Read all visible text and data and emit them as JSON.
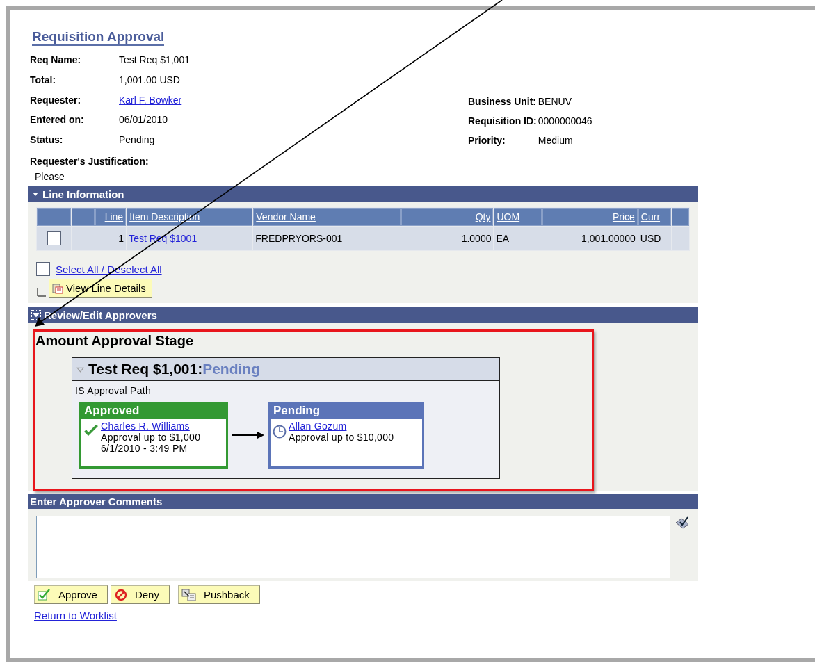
{
  "page_title": "Requisition Approval",
  "summary_fields": [
    {
      "label": "Req Name:",
      "value": "Test Req $1,001",
      "kind": "text"
    },
    {
      "label": "Total:",
      "value": "1,001.00 USD",
      "kind": "text"
    },
    {
      "label": "Requester:",
      "value": "Karl F. Bowker",
      "kind": "link"
    },
    {
      "label": "Entered on:",
      "value": "06/01/2010",
      "kind": "text"
    },
    {
      "label": "Status:",
      "value": "Pending",
      "kind": "text"
    }
  ],
  "info_fields": [
    {
      "label": "Business Unit:",
      "value": "BENUV"
    },
    {
      "label": "Requisition ID:",
      "value": "0000000046"
    },
    {
      "label": "Priority:",
      "value": "Medium"
    }
  ],
  "justification": {
    "label": "Requester's Justification:",
    "value": "Please"
  },
  "line_information": {
    "title": "Line Information",
    "expanded": true,
    "columns": [
      "Line",
      "Item Description",
      "Vendor Name",
      "Qty",
      "UOM",
      "Price",
      "Curr"
    ],
    "rows": [
      {
        "checked": false,
        "cells": [
          {
            "text": "1",
            "kind": "text"
          },
          {
            "text": "Test Req $1001",
            "kind": "link"
          },
          {
            "text": "FREDPRYORS-001",
            "kind": "text"
          },
          {
            "text": "1.0000",
            "kind": "text"
          },
          {
            "text": "EA",
            "kind": "text"
          },
          {
            "text": "1,001.00000",
            "kind": "text"
          },
          {
            "text": "USD",
            "kind": "text"
          }
        ]
      }
    ],
    "select_all": {
      "label": "Select All / Deselect All",
      "checked": false
    },
    "view_button": "View Line Details"
  },
  "approvers": {
    "title": "Review/Edit Approvers",
    "expanded": true,
    "stage": "Amount Approval Stage",
    "path_title": "Test Req $1,001:",
    "path_status": "Pending",
    "path_name": "IS Approval Path",
    "steps": [
      {
        "kind": "approved",
        "header": "Approved",
        "approver": "Charles R. Williams",
        "lines": [
          "Approval up to $1,000",
          "6/1/2010 - 3:49 PM"
        ]
      },
      {
        "kind": "pending",
        "header": "Pending",
        "approver": "Allan Gozum",
        "lines": [
          "Approval up to $10,000"
        ]
      }
    ]
  },
  "comments": {
    "title": "Enter Approver Comments"
  },
  "buttons": [
    {
      "kind": "approve",
      "label": "Approve"
    },
    {
      "kind": "deny",
      "label": "Deny"
    },
    {
      "kind": "pushback",
      "label": "Pushback"
    }
  ],
  "return_link": "Return to Worklist"
}
